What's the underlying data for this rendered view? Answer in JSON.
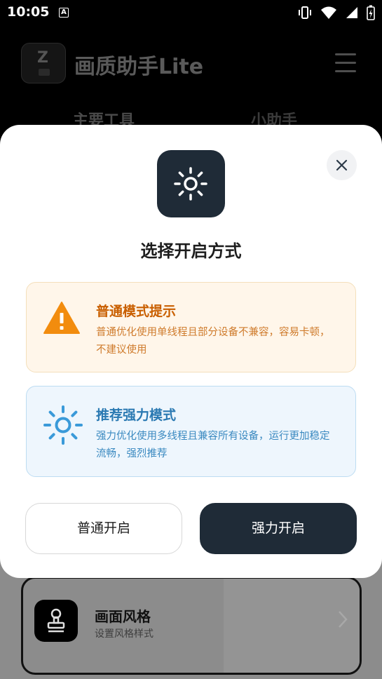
{
  "status_bar": {
    "time": "10:05",
    "notification_letter": "A",
    "icons": [
      "vibrate-icon",
      "wifi-icon",
      "signal-icon",
      "battery-icon"
    ]
  },
  "app": {
    "title": "画质助手Lite",
    "logo_letter": "Z",
    "tabs": [
      {
        "label": "主要工具"
      },
      {
        "label": "小助手"
      }
    ],
    "card": {
      "title": "画面风格",
      "subtitle": "设置风格样式",
      "icon": "stamp-icon"
    }
  },
  "dialog": {
    "title": "选择开启方式",
    "icon": "sun-icon",
    "close_icon": "close-icon",
    "normal_mode": {
      "title": "普通模式提示",
      "description": "普通优化使用单线程且部分设备不兼容，容易卡顿，不建议使用",
      "icon": "warning-icon"
    },
    "strong_mode": {
      "title": "推荐强力模式",
      "description": "强力优化使用多线程且兼容所有设备，运行更加稳定流畅，强烈推荐",
      "icon": "sun-icon"
    },
    "buttons": {
      "normal": "普通开启",
      "strong": "强力开启"
    }
  },
  "colors": {
    "primary_dark": "#1f2b37",
    "warning_orange": "#f28c0e",
    "info_blue": "#3a9ad9",
    "overlay_gray": "#8c8c8c"
  }
}
